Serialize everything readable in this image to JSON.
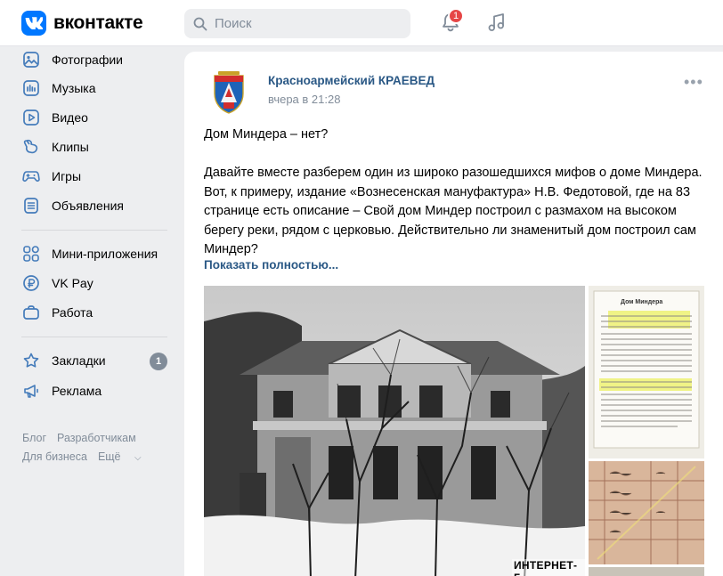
{
  "header": {
    "brand": "вконтакте",
    "search_placeholder": "Поиск",
    "notifications_count": "1"
  },
  "sidebar": {
    "items": [
      {
        "label": "Фотографии",
        "icon": "photos-icon"
      },
      {
        "label": "Музыка",
        "icon": "music-icon"
      },
      {
        "label": "Видео",
        "icon": "video-icon"
      },
      {
        "label": "Клипы",
        "icon": "clips-icon"
      },
      {
        "label": "Игры",
        "icon": "games-icon"
      },
      {
        "label": "Объявления",
        "icon": "classifieds-icon"
      }
    ],
    "items2": [
      {
        "label": "Мини-приложения",
        "icon": "mini-apps-icon"
      },
      {
        "label": "VK Pay",
        "icon": "vk-pay-icon"
      },
      {
        "label": "Работа",
        "icon": "work-icon"
      }
    ],
    "items3": [
      {
        "label": "Закладки",
        "icon": "bookmarks-icon",
        "count": "1"
      },
      {
        "label": "Реклама",
        "icon": "ads-icon"
      }
    ],
    "footer": {
      "blog": "Блог",
      "developers": "Разработчикам",
      "business": "Для бизнеса",
      "more": "Ещё"
    }
  },
  "post": {
    "author": "Красноармейский КРАЕВЕД",
    "time": "вчера в 21:28",
    "title": "Дом Миндера – нет?",
    "body": "Давайте вместе разберем один из широко разошедшихся мифов о доме Миндера. Вот, к примеру, издание «Вознесенская мануфактура» Н.В. Федотовой, где на 83 странице есть описание – Свой дом Миндер построил с размахом на высоком берегу реки, рядом с церковью. Действительно ли знаменитый дом построил сам Миндер?",
    "show_more": "Показать полностью...",
    "watermark": "ИНТЕРНЕТ-Г",
    "doc_heading": "Дом Миндера"
  },
  "colors": {
    "accent": "#0077ff",
    "link": "#2a5885",
    "muted": "#818c99",
    "badge_red": "#e64646"
  }
}
